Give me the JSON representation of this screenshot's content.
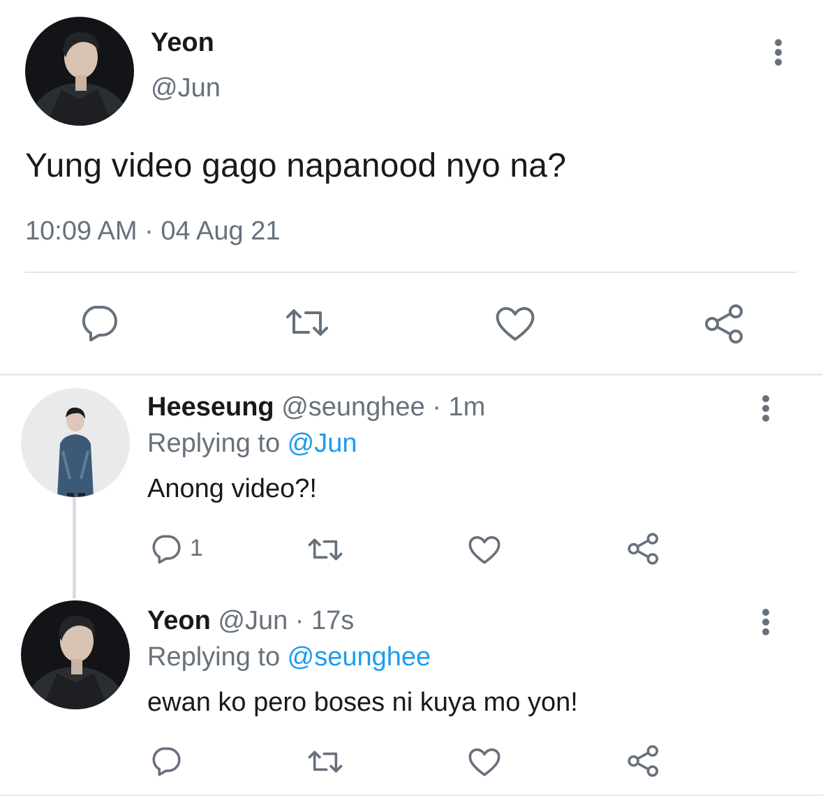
{
  "main_tweet": {
    "name": "Yeon",
    "handle": "@Jun",
    "text": "Yung video gago napanood nyo na?",
    "timestamp": "10:09 AM · 04 Aug 21",
    "actions": {
      "reply_icon": "speech-bubble-icon",
      "retweet_icon": "retweet-icon",
      "like_icon": "heart-icon",
      "share_icon": "share-icon"
    }
  },
  "replies": [
    {
      "name": "Heeseung",
      "meta": "@seunghee · 1m",
      "replying_prefix": "Replying to ",
      "replying_to": "@Jun",
      "text": "Anong video?!",
      "reply_count": "1"
    },
    {
      "name": "Yeon",
      "meta": "@Jun · 17s",
      "replying_prefix": "Replying to ",
      "replying_to": "@seunghee",
      "text": "ewan ko pero boses ni kuya mo yon!",
      "reply_count": ""
    }
  ],
  "colors": {
    "text_primary": "#17191c",
    "text_secondary": "#67717c",
    "link": "#1d9bf0",
    "icon": "#67717c"
  }
}
